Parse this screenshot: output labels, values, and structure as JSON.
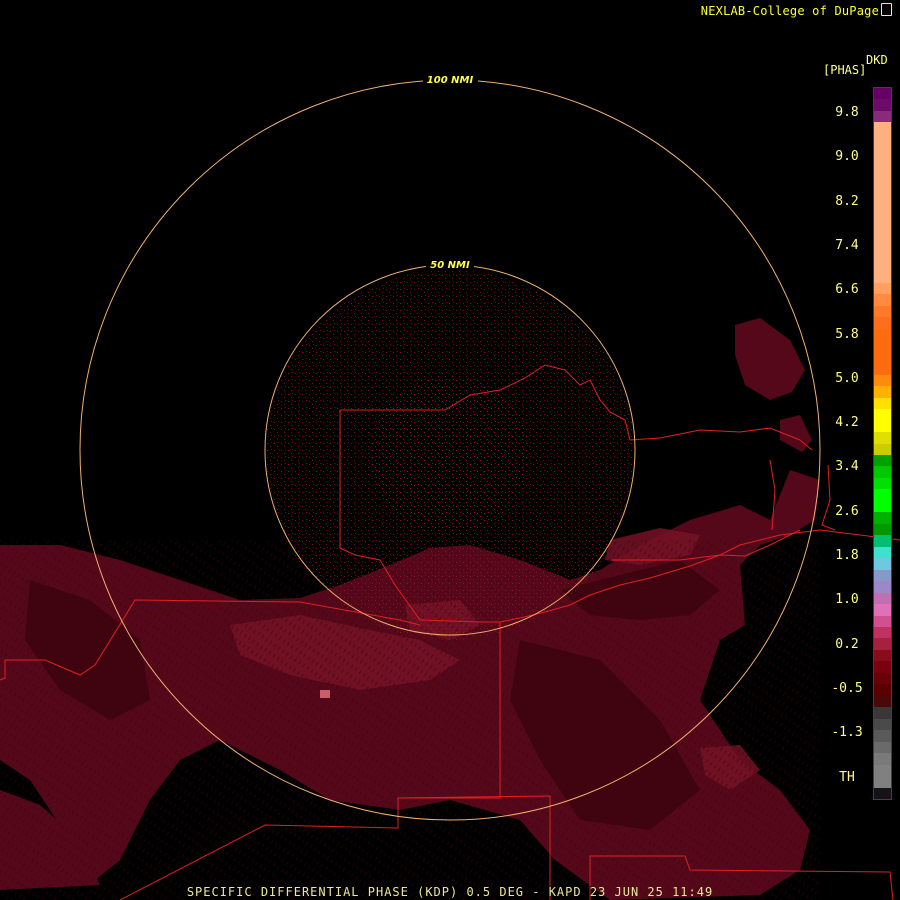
{
  "credit": "NEXLAB-College of DuPage",
  "footer": "SPECIFIC DIFFERENTIAL PHASE (KDP) 0.5 DEG - KAPD 23 JUN 25 11:49",
  "range_rings": [
    "100 NMI",
    "50 NMI"
  ],
  "legend": {
    "product": "DKD",
    "unit": "[PHAS]",
    "labels": [
      "9.8",
      "9.0",
      "8.2",
      "7.4",
      "6.6",
      "5.8",
      "5.0",
      "4.2",
      "3.4",
      "2.6",
      "1.8",
      "1.0",
      "0.2",
      "-0.5",
      "-1.3",
      "TH"
    ],
    "colors": [
      "#660066",
      "#6d0b6d",
      "#8a2a7a",
      "#ffb080",
      "#ffb080",
      "#ffb080",
      "#ffb080",
      "#ffb080",
      "#ffb080",
      "#ffb080",
      "#ffb080",
      "#ffb080",
      "#ffb080",
      "#ffb080",
      "#ffb080",
      "#ffb080",
      "#ffb080",
      "#ff9f60",
      "#ff8a40",
      "#ff7a28",
      "#ff6e1a",
      "#ff6c10",
      "#ff6c10",
      "#ff6c10",
      "#ff6c10",
      "#ff8a10",
      "#ffb000",
      "#ffe000",
      "#ffff00",
      "#ffff00",
      "#e0e000",
      "#cccc00",
      "#00a000",
      "#00c800",
      "#00e000",
      "#00ff00",
      "#00ff00",
      "#00b000",
      "#009600",
      "#00c070",
      "#40e0d0",
      "#70c8e0",
      "#8898c8",
      "#9a88c8",
      "#c070b0",
      "#e070b8",
      "#d05090",
      "#c03060",
      "#a82040",
      "#8a0c18",
      "#7a0010",
      "#6a0008",
      "#5a0000",
      "#4a0808",
      "#383838",
      "#4a4a4a",
      "#5a5a5a",
      "#6a6a6a",
      "#7a7a7a",
      "#808080",
      "#808080",
      "#141414"
    ]
  },
  "colors": {
    "background": "#000000",
    "range_ring": "#f0b070",
    "boundaries": "#e02020",
    "echo_light": "#5e0818",
    "echo_dark": "#45050f",
    "echo_bright": "#7a1428",
    "text": "#ffff88"
  }
}
